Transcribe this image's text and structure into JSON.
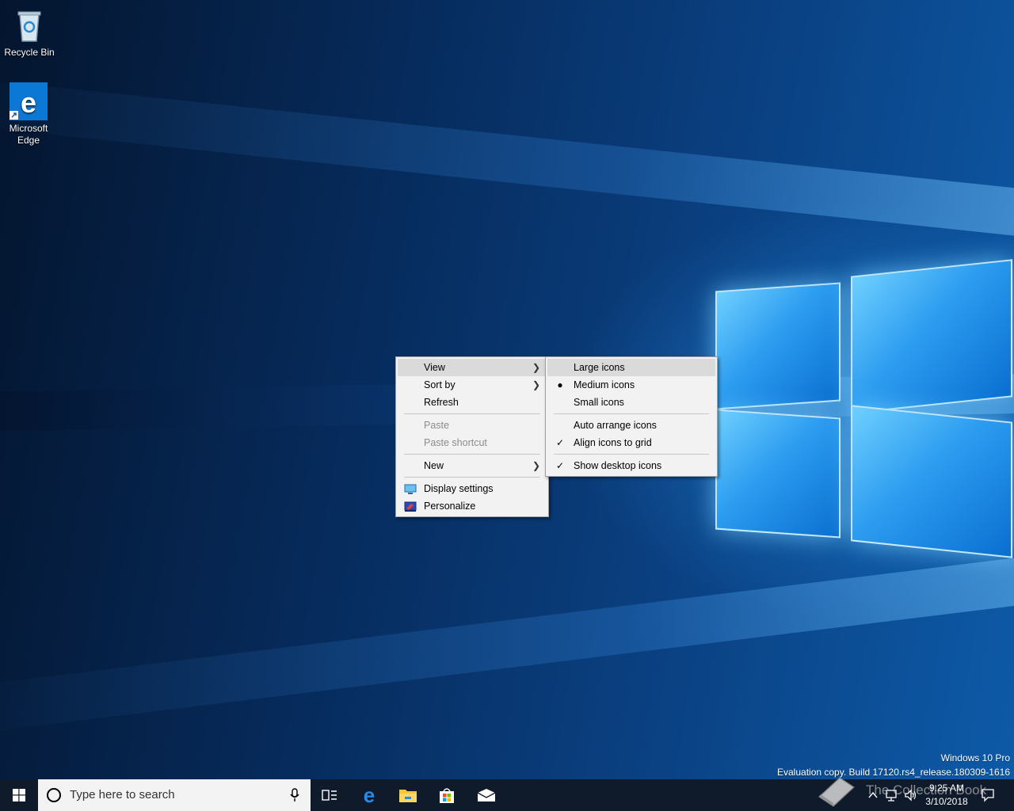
{
  "desktop": {
    "icons": [
      {
        "label": "Recycle Bin"
      },
      {
        "label": "Microsoft\nEdge"
      }
    ]
  },
  "context_menu": {
    "items": {
      "view": "View",
      "sort_by": "Sort by",
      "refresh": "Refresh",
      "paste": "Paste",
      "paste_shortcut": "Paste shortcut",
      "new": "New",
      "display_settings": "Display settings",
      "personalize": "Personalize"
    }
  },
  "view_submenu": {
    "items": {
      "large_icons": "Large icons",
      "medium_icons": "Medium icons",
      "small_icons": "Small icons",
      "auto_arrange": "Auto arrange icons",
      "align_to_grid": "Align icons to grid",
      "show_desktop_icons": "Show desktop icons"
    },
    "selected_size": "Medium icons",
    "checked": [
      "Align icons to grid",
      "Show desktop icons"
    ]
  },
  "watermark": {
    "edition": "Windows 10 Pro",
    "build": "Evaluation copy. Build 17120.rs4_release.180309-1616"
  },
  "taskbar": {
    "search_placeholder": "Type here to search",
    "pinned": [
      "task-view-icon",
      "edge-icon",
      "file-explorer-icon",
      "store-icon",
      "mail-icon"
    ],
    "clock_time": "9:25 AM",
    "clock_date": "3/10/2018",
    "overlay_text": "The Collection Book"
  },
  "colors": {
    "taskbar_bg": "#0f1a2a",
    "menu_bg": "#f2f2f2",
    "menu_highlight": "#dadada",
    "accent": "#0078d7"
  }
}
